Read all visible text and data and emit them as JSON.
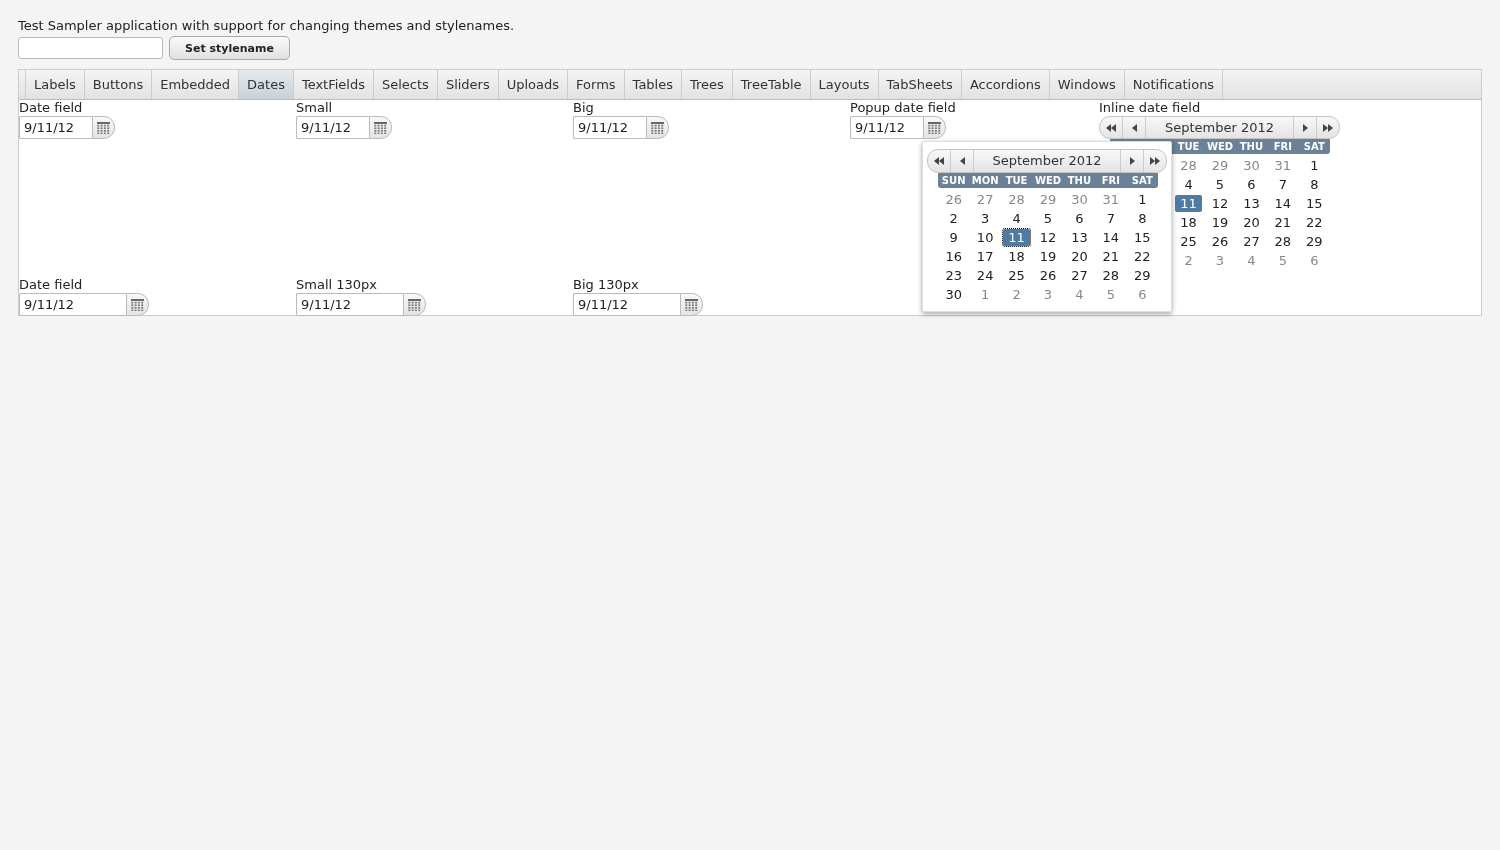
{
  "intro": "Test Sampler application with support for changing themes and stylenames.",
  "set_button": "Set stylename",
  "tabs": [
    {
      "label": "Labels",
      "selected": false
    },
    {
      "label": "Buttons",
      "selected": false
    },
    {
      "label": "Embedded",
      "selected": false
    },
    {
      "label": "Dates",
      "selected": true
    },
    {
      "label": "TextFields",
      "selected": false
    },
    {
      "label": "Selects",
      "selected": false
    },
    {
      "label": "Sliders",
      "selected": false
    },
    {
      "label": "Uploads",
      "selected": false
    },
    {
      "label": "Forms",
      "selected": false
    },
    {
      "label": "Tables",
      "selected": false
    },
    {
      "label": "Trees",
      "selected": false
    },
    {
      "label": "TreeTable",
      "selected": false
    },
    {
      "label": "Layouts",
      "selected": false
    },
    {
      "label": "TabSheets",
      "selected": false
    },
    {
      "label": "Accordions",
      "selected": false
    },
    {
      "label": "Windows",
      "selected": false
    },
    {
      "label": "Notifications",
      "selected": false
    }
  ],
  "field_rows": [
    [
      {
        "label": "Date field",
        "value": "9/11/12"
      },
      {
        "label": "Small",
        "value": "9/11/12"
      },
      {
        "label": "Big",
        "value": "9/11/12"
      }
    ],
    [
      {
        "label": "Date field",
        "value": "9/11/12"
      },
      {
        "label": "Small 130px",
        "value": "9/11/12"
      },
      {
        "label": "Big 130px",
        "value": "9/11/12"
      }
    ]
  ],
  "popup": {
    "label": "Popup date field",
    "value": "9/11/12",
    "calendar": {
      "month": "September 2012",
      "weekdays": [
        "SUN",
        "MON",
        "TUE",
        "WED",
        "THU",
        "FRI",
        "SAT"
      ],
      "weeks": [
        [
          {
            "day": "26",
            "other": true,
            "selected": false
          },
          {
            "day": "27",
            "other": true,
            "selected": false
          },
          {
            "day": "28",
            "other": true,
            "selected": false
          },
          {
            "day": "29",
            "other": true,
            "selected": false
          },
          {
            "day": "30",
            "other": true,
            "selected": false
          },
          {
            "day": "31",
            "other": true,
            "selected": false
          },
          {
            "day": "1",
            "other": false,
            "selected": false
          }
        ],
        [
          {
            "day": "2",
            "other": false,
            "selected": false
          },
          {
            "day": "3",
            "other": false,
            "selected": false
          },
          {
            "day": "4",
            "other": false,
            "selected": false
          },
          {
            "day": "5",
            "other": false,
            "selected": false
          },
          {
            "day": "6",
            "other": false,
            "selected": false
          },
          {
            "day": "7",
            "other": false,
            "selected": false
          },
          {
            "day": "8",
            "other": false,
            "selected": false
          }
        ],
        [
          {
            "day": "9",
            "other": false,
            "selected": false
          },
          {
            "day": "10",
            "other": false,
            "selected": false
          },
          {
            "day": "11",
            "other": false,
            "selected": true
          },
          {
            "day": "12",
            "other": false,
            "selected": false
          },
          {
            "day": "13",
            "other": false,
            "selected": false
          },
          {
            "day": "14",
            "other": false,
            "selected": false
          },
          {
            "day": "15",
            "other": false,
            "selected": false
          }
        ],
        [
          {
            "day": "16",
            "other": false,
            "selected": false
          },
          {
            "day": "17",
            "other": false,
            "selected": false
          },
          {
            "day": "18",
            "other": false,
            "selected": false
          },
          {
            "day": "19",
            "other": false,
            "selected": false
          },
          {
            "day": "20",
            "other": false,
            "selected": false
          },
          {
            "day": "21",
            "other": false,
            "selected": false
          },
          {
            "day": "22",
            "other": false,
            "selected": false
          }
        ],
        [
          {
            "day": "23",
            "other": false,
            "selected": false
          },
          {
            "day": "24",
            "other": false,
            "selected": false
          },
          {
            "day": "25",
            "other": false,
            "selected": false
          },
          {
            "day": "26",
            "other": false,
            "selected": false
          },
          {
            "day": "27",
            "other": false,
            "selected": false
          },
          {
            "day": "28",
            "other": false,
            "selected": false
          },
          {
            "day": "29",
            "other": false,
            "selected": false
          }
        ],
        [
          {
            "day": "30",
            "other": false,
            "selected": false
          },
          {
            "day": "1",
            "other": true,
            "selected": false
          },
          {
            "day": "2",
            "other": true,
            "selected": false
          },
          {
            "day": "3",
            "other": true,
            "selected": false
          },
          {
            "day": "4",
            "other": true,
            "selected": false
          },
          {
            "day": "5",
            "other": true,
            "selected": false
          },
          {
            "day": "6",
            "other": true,
            "selected": false
          }
        ]
      ]
    }
  },
  "inline": {
    "label": "Inline date field",
    "calendar": {
      "month": "September 2012",
      "weekdays": [
        "TUE",
        "WED",
        "THU",
        "FRI",
        "SAT"
      ],
      "weeks": [
        [
          {
            "day": "28",
            "other": true,
            "selected": false
          },
          {
            "day": "29",
            "other": true,
            "selected": false
          },
          {
            "day": "30",
            "other": true,
            "selected": false
          },
          {
            "day": "31",
            "other": true,
            "selected": false
          },
          {
            "day": "1",
            "other": false,
            "selected": false
          }
        ],
        [
          {
            "day": "4",
            "other": false,
            "selected": false
          },
          {
            "day": "5",
            "other": false,
            "selected": false
          },
          {
            "day": "6",
            "other": false,
            "selected": false
          },
          {
            "day": "7",
            "other": false,
            "selected": false
          },
          {
            "day": "8",
            "other": false,
            "selected": false
          }
        ],
        [
          {
            "day": "11",
            "other": false,
            "selected": true
          },
          {
            "day": "12",
            "other": false,
            "selected": false
          },
          {
            "day": "13",
            "other": false,
            "selected": false
          },
          {
            "day": "14",
            "other": false,
            "selected": false
          },
          {
            "day": "15",
            "other": false,
            "selected": false
          }
        ],
        [
          {
            "day": "18",
            "other": false,
            "selected": false
          },
          {
            "day": "19",
            "other": false,
            "selected": false
          },
          {
            "day": "20",
            "other": false,
            "selected": false
          },
          {
            "day": "21",
            "other": false,
            "selected": false
          },
          {
            "day": "22",
            "other": false,
            "selected": false
          }
        ],
        [
          {
            "day": "25",
            "other": false,
            "selected": false
          },
          {
            "day": "26",
            "other": false,
            "selected": false
          },
          {
            "day": "27",
            "other": false,
            "selected": false
          },
          {
            "day": "28",
            "other": false,
            "selected": false
          },
          {
            "day": "29",
            "other": false,
            "selected": false
          }
        ],
        [
          {
            "day": "2",
            "other": true,
            "selected": false
          },
          {
            "day": "3",
            "other": true,
            "selected": false
          },
          {
            "day": "4",
            "other": true,
            "selected": false
          },
          {
            "day": "5",
            "other": true,
            "selected": false
          },
          {
            "day": "6",
            "other": true,
            "selected": false
          }
        ]
      ]
    }
  }
}
